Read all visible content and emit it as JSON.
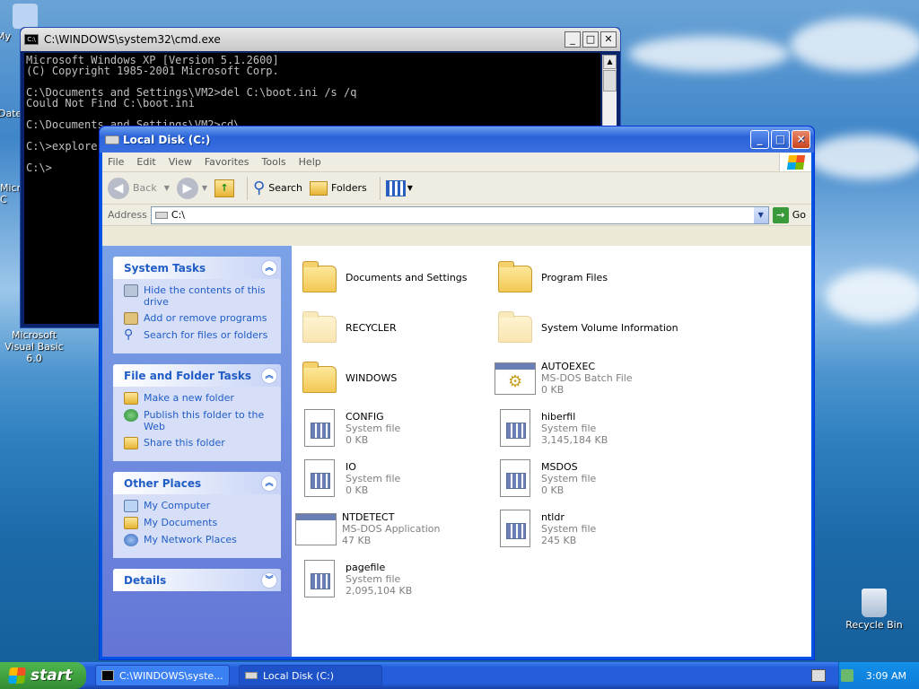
{
  "desktop": {
    "icons": [
      {
        "label": "My"
      },
      {
        "label": "Date"
      },
      {
        "label": "Micro C"
      },
      {
        "label": "Microsoft Visual Basic 6.0"
      },
      {
        "label": "Recycle Bin"
      }
    ]
  },
  "cmd": {
    "title": "C:\\WINDOWS\\system32\\cmd.exe",
    "icon": "cmd-icon",
    "lines": [
      "Microsoft Windows XP [Version 5.1.2600]",
      "(C) Copyright 1985-2001 Microsoft Corp.",
      "",
      "C:\\Documents and Settings\\VM2>del C:\\boot.ini /s /q",
      "Could Not Find C:\\boot.ini",
      "",
      "C:\\Documents and Settings\\VM2>cd\\",
      "",
      "C:\\>explore",
      "",
      "C:\\>"
    ]
  },
  "explorer": {
    "title": "Local Disk (C:)",
    "menu": [
      "File",
      "Edit",
      "View",
      "Favorites",
      "Tools",
      "Help"
    ],
    "toolbar": {
      "back": "Back",
      "search": "Search",
      "folders": "Folders"
    },
    "address": {
      "label": "Address",
      "value": "C:\\",
      "go": "Go"
    },
    "panels": [
      {
        "title": "System Tasks",
        "items": [
          {
            "label": "Hide the contents of this drive",
            "icon": "drive-icon"
          },
          {
            "label": "Add or remove programs",
            "icon": "programs-icon"
          },
          {
            "label": "Search for files or folders",
            "icon": "search-icon"
          }
        ]
      },
      {
        "title": "File and Folder Tasks",
        "items": [
          {
            "label": "Make a new folder",
            "icon": "new-folder-icon"
          },
          {
            "label": "Publish this folder to the Web",
            "icon": "globe-icon"
          },
          {
            "label": "Share this folder",
            "icon": "share-icon"
          }
        ]
      },
      {
        "title": "Other Places",
        "items": [
          {
            "label": "My Computer",
            "icon": "computer-icon"
          },
          {
            "label": "My Documents",
            "icon": "documents-icon"
          },
          {
            "label": "My Network Places",
            "icon": "network-icon"
          }
        ]
      },
      {
        "title": "Details",
        "items": []
      }
    ],
    "files": [
      {
        "name": "Documents and Settings",
        "type": "",
        "size": "",
        "icon": "folder-icon"
      },
      {
        "name": "Program Files",
        "type": "",
        "size": "",
        "icon": "folder-icon"
      },
      {
        "name": "RECYCLER",
        "type": "",
        "size": "",
        "icon": "hidden-folder-icon"
      },
      {
        "name": "System Volume Information",
        "type": "",
        "size": "",
        "icon": "hidden-folder-icon"
      },
      {
        "name": "WINDOWS",
        "type": "",
        "size": "",
        "icon": "folder-icon"
      },
      {
        "name": "AUTOEXEC",
        "type": "MS-DOS Batch File",
        "size": "0 KB",
        "icon": "batch-file-icon"
      },
      {
        "name": "CONFIG",
        "type": "System file",
        "size": "0 KB",
        "icon": "system-file-icon"
      },
      {
        "name": "hiberfil",
        "type": "System file",
        "size": "3,145,184 KB",
        "icon": "system-file-icon"
      },
      {
        "name": "IO",
        "type": "System file",
        "size": "0 KB",
        "icon": "system-file-icon"
      },
      {
        "name": "MSDOS",
        "type": "System file",
        "size": "0 KB",
        "icon": "system-file-icon"
      },
      {
        "name": "NTDETECT",
        "type": "MS-DOS Application",
        "size": "47 KB",
        "icon": "application-icon"
      },
      {
        "name": "ntldr",
        "type": "System file",
        "size": "245 KB",
        "icon": "system-file-icon"
      },
      {
        "name": "pagefile",
        "type": "System file",
        "size": "2,095,104 KB",
        "icon": "system-file-icon"
      }
    ]
  },
  "taskbar": {
    "start": "start",
    "buttons": [
      {
        "label": "C:\\WINDOWS\\syste..."
      },
      {
        "label": "Local Disk (C:)"
      }
    ],
    "clock": "3:09 AM"
  }
}
